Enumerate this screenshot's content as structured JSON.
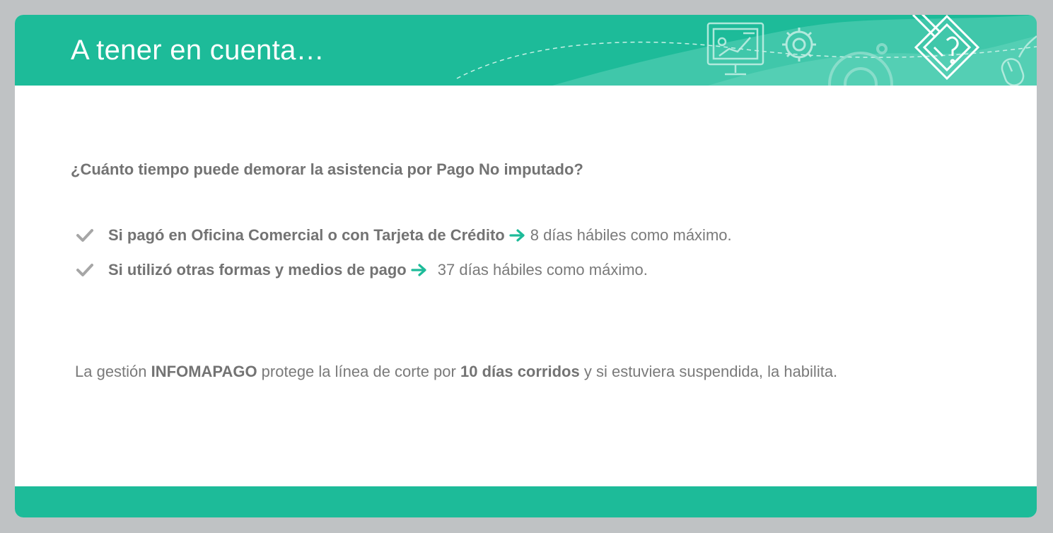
{
  "header": {
    "title": "A tener en cuenta…",
    "icons": [
      "presentation-screen-icon",
      "gear-icon",
      "large-gear-icon",
      "checklist-pencil-icon",
      "mouse-icon"
    ]
  },
  "colors": {
    "accent": "#1dbb99",
    "text_gray": "#7a7a7a",
    "check_gray": "#a6a6a6"
  },
  "content": {
    "question": "¿Cuánto tiempo puede demorar la asistencia por Pago No imputado?",
    "bullets": [
      {
        "bold": "Si pagó en Oficina Comercial o con Tarjeta de Crédito",
        "value": "8 días hábiles como máximo."
      },
      {
        "bold": "Si utilizó otras formas y medios de pago",
        "value": "37 días hábiles como máximo."
      }
    ],
    "note": {
      "part1": "La gestión ",
      "bold1": "INFOMAPAGO",
      "part2": " protege la línea de corte por ",
      "bold2": "10 días corridos",
      "part3": " y si estuviera suspendida, la habilita."
    }
  }
}
